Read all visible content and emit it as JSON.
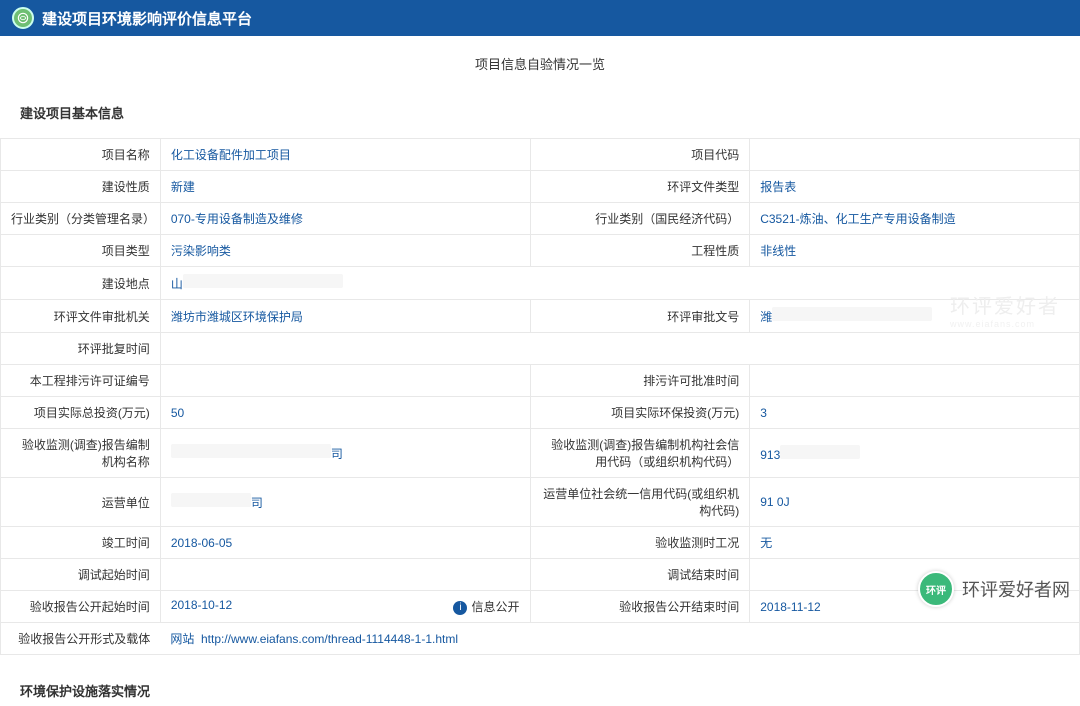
{
  "header": {
    "platform_name": "建设项目环境影响评价信息平台"
  },
  "page_subtitle": "项目信息自验情况一览",
  "section1_title": "建设项目基本信息",
  "section2_title": "环境保护设施落实情况",
  "form": {
    "project_name_l": "项目名称",
    "project_name_v": "化工设备配件加工项目",
    "project_code_l": "项目代码",
    "project_code_v": "",
    "build_nature_l": "建设性质",
    "build_nature_v": "新建",
    "eia_doc_type_l": "环评文件类型",
    "eia_doc_type_v": "报告表",
    "industry_cat_l": "行业类别（分类管理名录）",
    "industry_cat_v": "070-专用设备制造及维修",
    "industry_econ_l": "行业类别（国民经济代码）",
    "industry_econ_v": "C3521-炼油、化工生产专用设备制造",
    "project_type_l": "项目类型",
    "project_type_v": "污染影响类",
    "eng_nature_l": "工程性质",
    "eng_nature_v": "非线性",
    "build_addr_l": "建设地点",
    "build_addr_v": "山",
    "eia_review_org_l": "环评文件审批机关",
    "eia_review_org_v": "潍坊市潍城区环境保护局",
    "eia_approval_no_l": "环评审批文号",
    "eia_approval_no_v": "潍",
    "eia_approval_time_l": "环评批复时间",
    "eia_approval_time_v": "",
    "discharge_permit_no_l": "本工程排污许可证编号",
    "discharge_permit_no_v": "",
    "discharge_permit_time_l": "排污许可批准时间",
    "discharge_permit_time_v": "",
    "total_invest_l": "项目实际总投资(万元)",
    "total_invest_v": "50",
    "env_invest_l": "项目实际环保投资(万元)",
    "env_invest_v": "3",
    "accept_org_name_l": "验收监测(调查)报告编制机构名称",
    "accept_org_name_v": "司",
    "accept_org_code_l": "验收监测(调查)报告编制机构社会信用代码（或组织机构代码）",
    "accept_org_code_v": "913",
    "operator_l": "运营单位",
    "operator_v": "司",
    "operator_code_l": "运营单位社会统一信用代码(或组织机构代码)",
    "operator_code_v": "91                                       0J",
    "complete_time_l": "竣工时间",
    "complete_time_v": "2018-06-05",
    "monitor_status_l": "验收监测时工况",
    "monitor_status_v": "无",
    "debug_start_l": "调试起始时间",
    "debug_start_v": "",
    "debug_end_l": "调试结束时间",
    "debug_end_v": "",
    "report_pub_start_l": "验收报告公开起始时间",
    "report_pub_start_v": "2018-10-12",
    "info_public_badge": "信息公开",
    "report_pub_end_l": "验收报告公开结束时间",
    "report_pub_end_v": "2018-11-12",
    "report_pub_media_l": "验收报告公开形式及载体",
    "report_pub_media_prefix": "网站",
    "report_pub_media_url": "http://www.eiafans.com/thread-1114448-1-1.html"
  },
  "watermark": {
    "brand": "环评爱好者网",
    "ghost": "环评爱好者",
    "ghost_sub": "www.eiafans.com",
    "avatar": "环评"
  }
}
